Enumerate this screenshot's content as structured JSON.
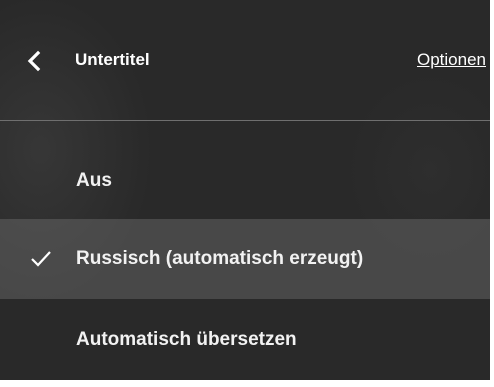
{
  "header": {
    "back_icon": "chevron-left-icon",
    "title": "Untertitel",
    "options_label": "Optionen"
  },
  "menu": {
    "items": [
      {
        "label": "Aus",
        "selected": false
      },
      {
        "label": "Russisch (automatisch erzeugt)",
        "selected": true,
        "icon": "checkmark-icon"
      },
      {
        "label": "Automatisch übersetzen",
        "selected": false
      }
    ]
  }
}
